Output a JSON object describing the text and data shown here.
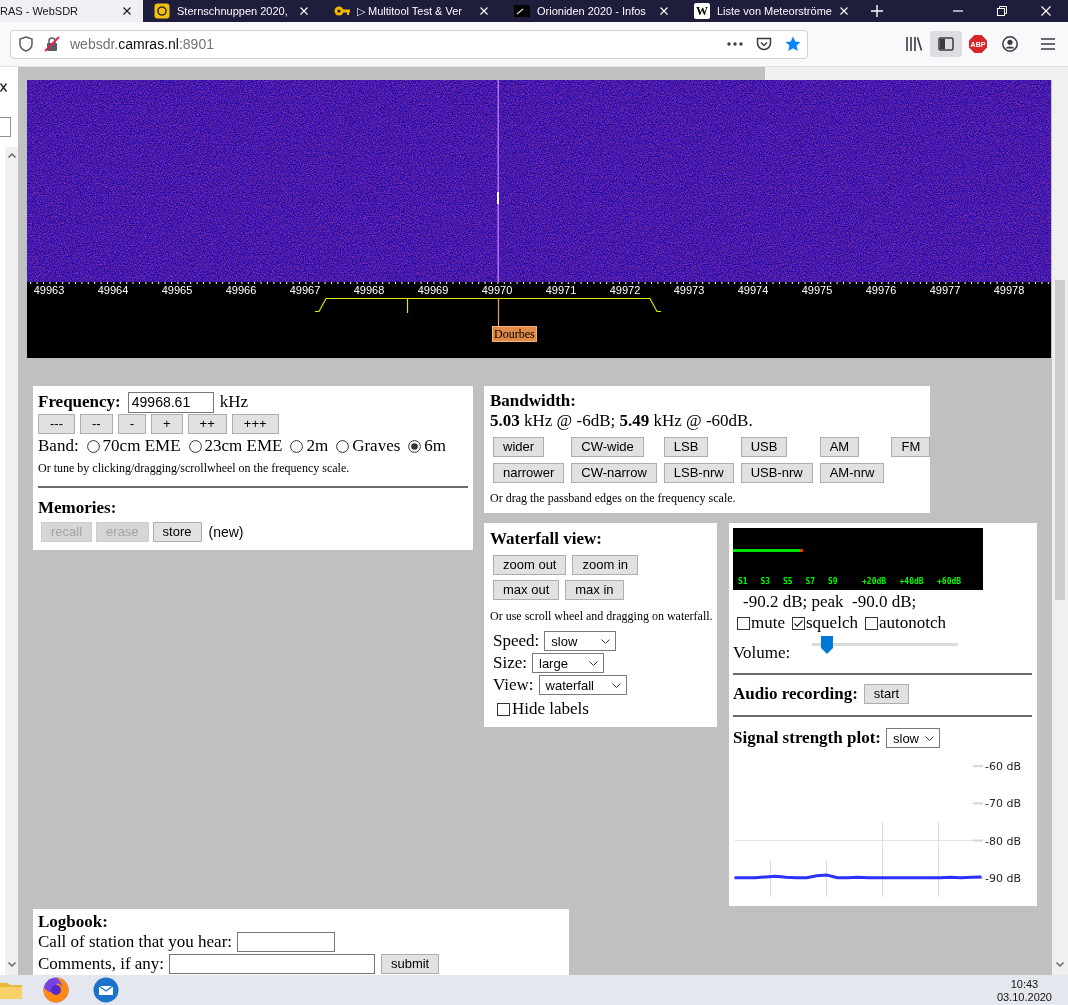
{
  "browser": {
    "tabs": [
      {
        "title": "RAS - WebSDR",
        "selected": true
      },
      {
        "title": "Sternschnuppen 2020,",
        "selected": false
      },
      {
        "title": "▷ Multitool Test & Ver",
        "selected": false
      },
      {
        "title": "Orioniden 2020 - Infos",
        "selected": false
      },
      {
        "title": "Liste von Meteorströme",
        "selected": false,
        "icon_text": "W"
      }
    ],
    "url": "websdr.**camras.nl**:8901",
    "sidebar_button": {
      "on": true
    },
    "adblock_badge": "ABP"
  },
  "waterfall": {
    "scale_labels": [
      "49963",
      "49964",
      "49965",
      "49966",
      "49967",
      "49968",
      "49969",
      "49970",
      "49971",
      "49972",
      "49973",
      "49974",
      "49975",
      "49976",
      "49977",
      "49978"
    ],
    "station_label": "Dourbes"
  },
  "frequency": {
    "label": "Frequency:",
    "value": "49968.61",
    "unit": "kHz",
    "step_buttons": [
      "---",
      "--",
      "-",
      "+",
      "++",
      "+++"
    ],
    "band_label": "Band:",
    "bands": [
      {
        "label": "70cm EME",
        "selected": false
      },
      {
        "label": "23cm EME",
        "selected": false
      },
      {
        "label": "2m",
        "selected": false
      },
      {
        "label": "Graves",
        "selected": false
      },
      {
        "label": "6m",
        "selected": true
      }
    ],
    "hint": "Or tune by clicking/dragging/scrollwheel on the frequency scale."
  },
  "memories": {
    "title": "Memories:",
    "buttons": [
      {
        "label": "recall",
        "disabled": true
      },
      {
        "label": "erase",
        "disabled": true
      },
      {
        "label": "store",
        "disabled": false
      }
    ],
    "status": "(new)"
  },
  "bandwidth": {
    "title": "Bandwidth:",
    "summary": "**5.03** kHz @ -6dB; **5.49** kHz @ -60dB.",
    "button_rows": [
      [
        "wider",
        "CW-wide",
        "LSB",
        "USB",
        "AM",
        "FM"
      ],
      [
        "narrower",
        "CW-narrow",
        "LSB-nrw",
        "USB-nrw",
        "AM-nrw"
      ]
    ],
    "hint": "Or drag the passband edges on the frequency scale."
  },
  "waterfall_view": {
    "title": "Waterfall view:",
    "button_rows": [
      [
        "zoom out",
        "zoom in"
      ],
      [
        "max out",
        "max in"
      ]
    ],
    "hint": "Or use scroll wheel and dragging on waterfall.",
    "selects": [
      {
        "label": "Speed:",
        "value": "slow"
      },
      {
        "label": "Size:",
        "value": "large"
      },
      {
        "label": "View:",
        "value": "waterfall"
      }
    ],
    "hide_labels": {
      "label": "Hide labels",
      "checked": false
    }
  },
  "audio": {
    "smeter": {
      "level": 0.28,
      "scale": [
        "S1",
        "S3",
        "S5",
        "S7",
        "S9",
        "+20dB",
        "+40dB",
        "+60dB"
      ]
    },
    "reading": "-90.2 dB; peak  -90.0 dB;",
    "options": [
      {
        "label": "mute",
        "checked": false
      },
      {
        "label": "squelch",
        "checked": true
      },
      {
        "label": "autonotch",
        "checked": false
      }
    ],
    "volume": {
      "label": "Volume:",
      "level": 0.1
    },
    "recording": {
      "label": "Audio recording:",
      "button": "start"
    },
    "plot": {
      "label": "Signal strength plot:",
      "speed": "slow",
      "chart_data": {
        "type": "line",
        "ylim": [
          -90,
          -60
        ],
        "yticks": [
          {
            "value": -60,
            "label": "-60 dB"
          },
          {
            "value": -70,
            "label": "-70 dB"
          },
          {
            "value": -80,
            "label": "-80 dB"
          },
          {
            "value": -90,
            "label": "-90 dB"
          }
        ],
        "series": [
          {
            "color": "#2f2fff",
            "values": [
              -90.0,
              -90.0,
              -90.0,
              -89.8,
              -89.6,
              -89.9,
              -90.0,
              -90.0,
              -89.5,
              -89.3,
              -90.0,
              -90.0,
              -89.9,
              -90.0,
              -90.0,
              -90.0,
              -90.0,
              -90.0,
              -90.0,
              -90.0,
              -90.0,
              -89.9,
              -90.0,
              -89.9,
              -89.8
            ]
          }
        ]
      }
    }
  },
  "logbook": {
    "title": "Logbook:",
    "call_label": "Call of station that you hear:",
    "comments_label": "Comments, if any:",
    "submit": "submit"
  },
  "taskbar": {
    "time": "10:43",
    "date": "03.10.2020"
  }
}
